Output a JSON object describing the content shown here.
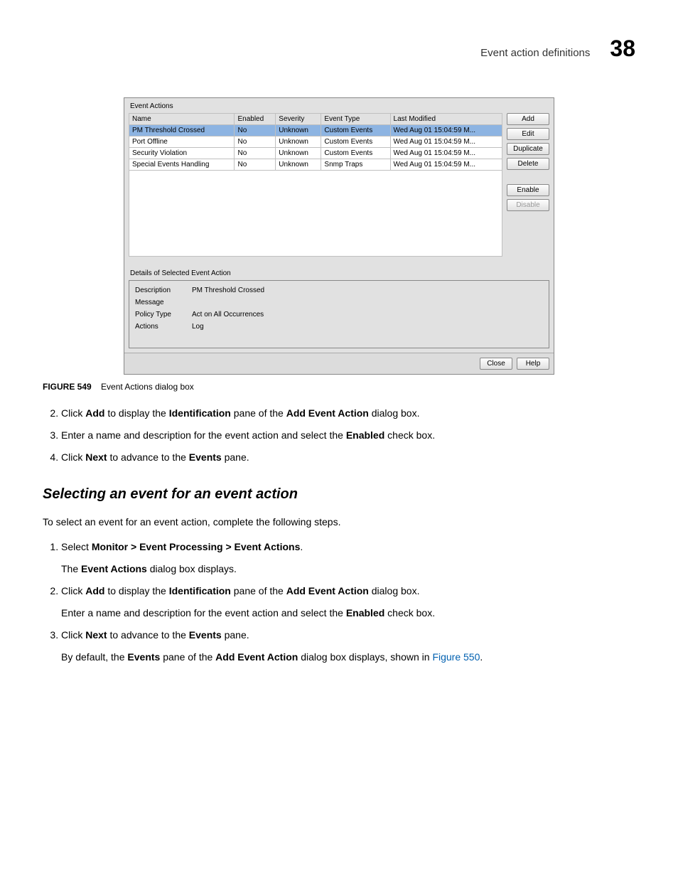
{
  "header": {
    "title": "Event action definitions",
    "chapter": "38"
  },
  "dialog": {
    "title": "Event Actions",
    "columns": [
      "Name",
      "Enabled",
      "Severity",
      "Event Type",
      "Last Modified"
    ],
    "rows": [
      {
        "name": "PM Threshold Crossed",
        "enabled": "No",
        "severity": "Unknown",
        "etype": "Custom Events",
        "modified": "Wed Aug 01 15:04:59 M...",
        "selected": true
      },
      {
        "name": "Port Offline",
        "enabled": "No",
        "severity": "Unknown",
        "etype": "Custom Events",
        "modified": "Wed Aug 01 15:04:59 M..."
      },
      {
        "name": "Security Violation",
        "enabled": "No",
        "severity": "Unknown",
        "etype": "Custom Events",
        "modified": "Wed Aug 01 15:04:59 M..."
      },
      {
        "name": "Special Events Handling",
        "enabled": "No",
        "severity": "Unknown",
        "etype": "Snmp Traps",
        "modified": "Wed Aug 01 15:04:59 M..."
      }
    ],
    "buttons": {
      "add": "Add",
      "edit": "Edit",
      "duplicate": "Duplicate",
      "delete": "Delete",
      "enable": "Enable",
      "disable": "Disable"
    },
    "detailsLabel": "Details of Selected Event Action",
    "details": {
      "description_label": "Description",
      "description_value": "PM Threshold Crossed",
      "message_label": "Message",
      "message_value": "",
      "policy_label": "Policy Type",
      "policy_value": "Act on All Occurrences",
      "actions_label": "Actions",
      "actions_value": "Log"
    },
    "bottom": {
      "close": "Close",
      "help": "Help"
    }
  },
  "figure": {
    "label": "FIGURE 549",
    "caption": "Event Actions dialog box"
  },
  "stepsA": {
    "s2_a": "Click ",
    "s2_b": "Add",
    "s2_c": " to display the ",
    "s2_d": "Identification",
    "s2_e": " pane of the ",
    "s2_f": "Add Event Action",
    "s2_g": " dialog box.",
    "s3_a": "Enter a name and description for the event action and select the ",
    "s3_b": "Enabled",
    "s3_c": " check box.",
    "s4_a": "Click ",
    "s4_b": "Next",
    "s4_c": " to advance to the ",
    "s4_d": "Events",
    "s4_e": " pane."
  },
  "section": {
    "heading": "Selecting an event for an event action",
    "intro": "To select an event for an event action, complete the following steps."
  },
  "stepsB": {
    "s1_a": "Select ",
    "s1_b": "Monitor > Event Processing > Event Actions",
    "s1_c": ".",
    "s1_sub_a": "The ",
    "s1_sub_b": "Event Actions",
    "s1_sub_c": " dialog box displays.",
    "s2_a": "Click ",
    "s2_b": "Add",
    "s2_c": " to display the ",
    "s2_d": "Identification",
    "s2_e": " pane of the ",
    "s2_f": "Add Event Action",
    "s2_g": " dialog box.",
    "s2_sub_a": "Enter a name and description for the event action and select the ",
    "s2_sub_b": "Enabled",
    "s2_sub_c": " check box.",
    "s3_a": "Click ",
    "s3_b": "Next",
    "s3_c": " to advance to the ",
    "s3_d": "Events",
    "s3_e": " pane.",
    "s3_sub_a": "By default, the ",
    "s3_sub_b": "Events",
    "s3_sub_c": " pane of the ",
    "s3_sub_d": "Add Event Action",
    "s3_sub_e": " dialog box displays, shown in ",
    "s3_sub_link": "Figure 550",
    "s3_sub_end": "."
  }
}
